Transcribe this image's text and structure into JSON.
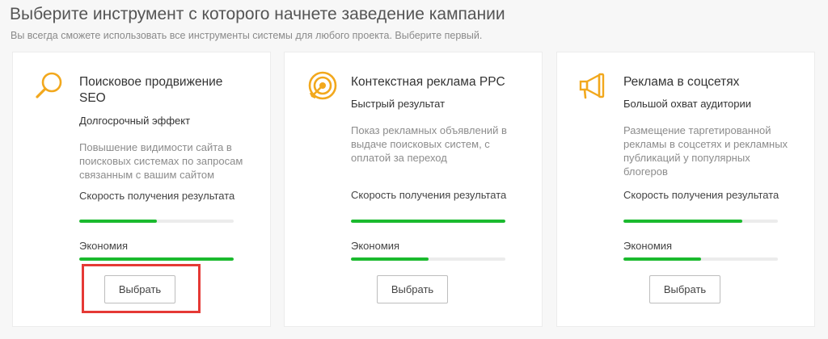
{
  "header": {
    "title": "Выберите инструмент с которого начнете заведение кампании",
    "subtitle": "Вы всегда сможете использовать все инструменты системы для любого проекта. Выберите первый."
  },
  "accent_color": "#f2a81d",
  "progress_color": "#1bba2e",
  "highlight_color": "#e53935",
  "cards": [
    {
      "icon": "magnifier-icon",
      "title": "Поисковое продвижение SEO",
      "tagline": "Долгосрочный эффект",
      "description": "Повышение видимости сайта в поисковых системах по запросам связанным с вашим сайтом",
      "metrics": [
        {
          "label": "Скорость получения результата",
          "value": 0.5
        },
        {
          "label": "Экономия",
          "value": 1.0
        }
      ],
      "button_label": "Выбрать"
    },
    {
      "icon": "target-icon",
      "title": "Контекстная реклама PPC",
      "tagline": "Быстрый результат",
      "description": "Показ рекламных объявлений в выдаче поисковых систем, с оплатой за переход",
      "metrics": [
        {
          "label": "Скорость получения результата",
          "value": 1.0
        },
        {
          "label": "Экономия",
          "value": 0.5
        }
      ],
      "button_label": "Выбрать"
    },
    {
      "icon": "megaphone-icon",
      "title": "Реклама в соцсетях",
      "tagline": "Большой охват аудитории",
      "description": "Размещение таргетированной рекламы в соцсетях и рекламных публикаций у популярных блогеров",
      "metrics": [
        {
          "label": "Скорость получения результата",
          "value": 0.77
        },
        {
          "label": "Экономия",
          "value": 0.5
        }
      ],
      "button_label": "Выбрать"
    }
  ]
}
